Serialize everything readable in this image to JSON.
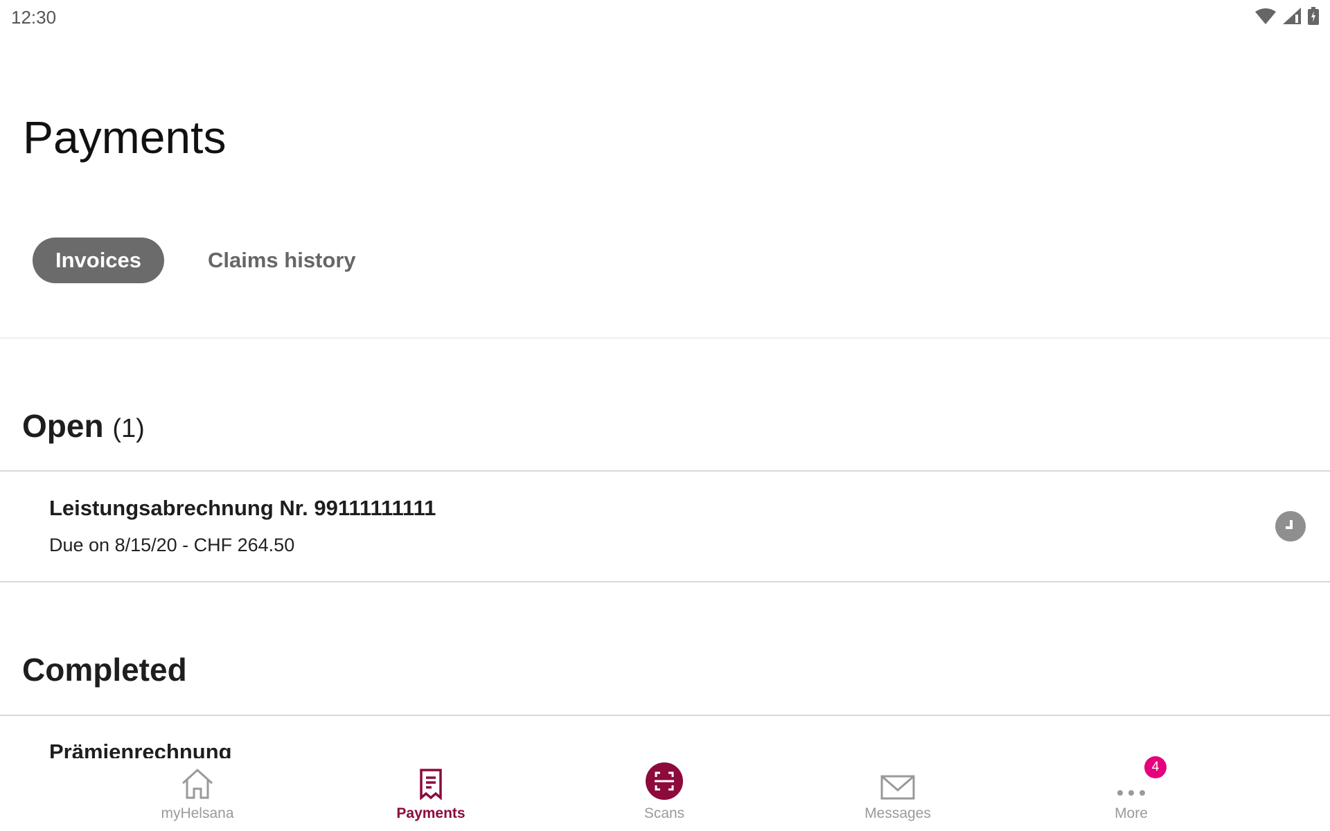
{
  "status_bar": {
    "time": "12:30",
    "icons": [
      "wifi-icon",
      "signal-icon",
      "battery-charging-icon"
    ]
  },
  "page": {
    "title": "Payments"
  },
  "tabs": [
    {
      "label": "Invoices",
      "active": true
    },
    {
      "label": "Claims history",
      "active": false
    }
  ],
  "open": {
    "label": "Open",
    "count": "(1)",
    "items": [
      {
        "title": "Leistungsabrechnung Nr. 99111111111",
        "subtitle": "Due on 8/15/20 - CHF 264.50",
        "status_icon": "clock-icon"
      }
    ]
  },
  "completed": {
    "label": "Completed",
    "items": [
      {
        "title": "Prämienrechnung"
      }
    ]
  },
  "nav": {
    "items": [
      {
        "label": "myHelsana",
        "icon": "home-icon"
      },
      {
        "label": "Payments",
        "icon": "receipt-icon",
        "active": true
      },
      {
        "label": "Scans",
        "icon": "scan-icon"
      },
      {
        "label": "Messages",
        "icon": "envelope-icon"
      },
      {
        "label": "More",
        "icon": "more-icon",
        "badge": "4"
      }
    ]
  },
  "colors": {
    "accent": "#8c0a3c",
    "badge": "#e6007e",
    "pill": "#6b6b6b"
  }
}
